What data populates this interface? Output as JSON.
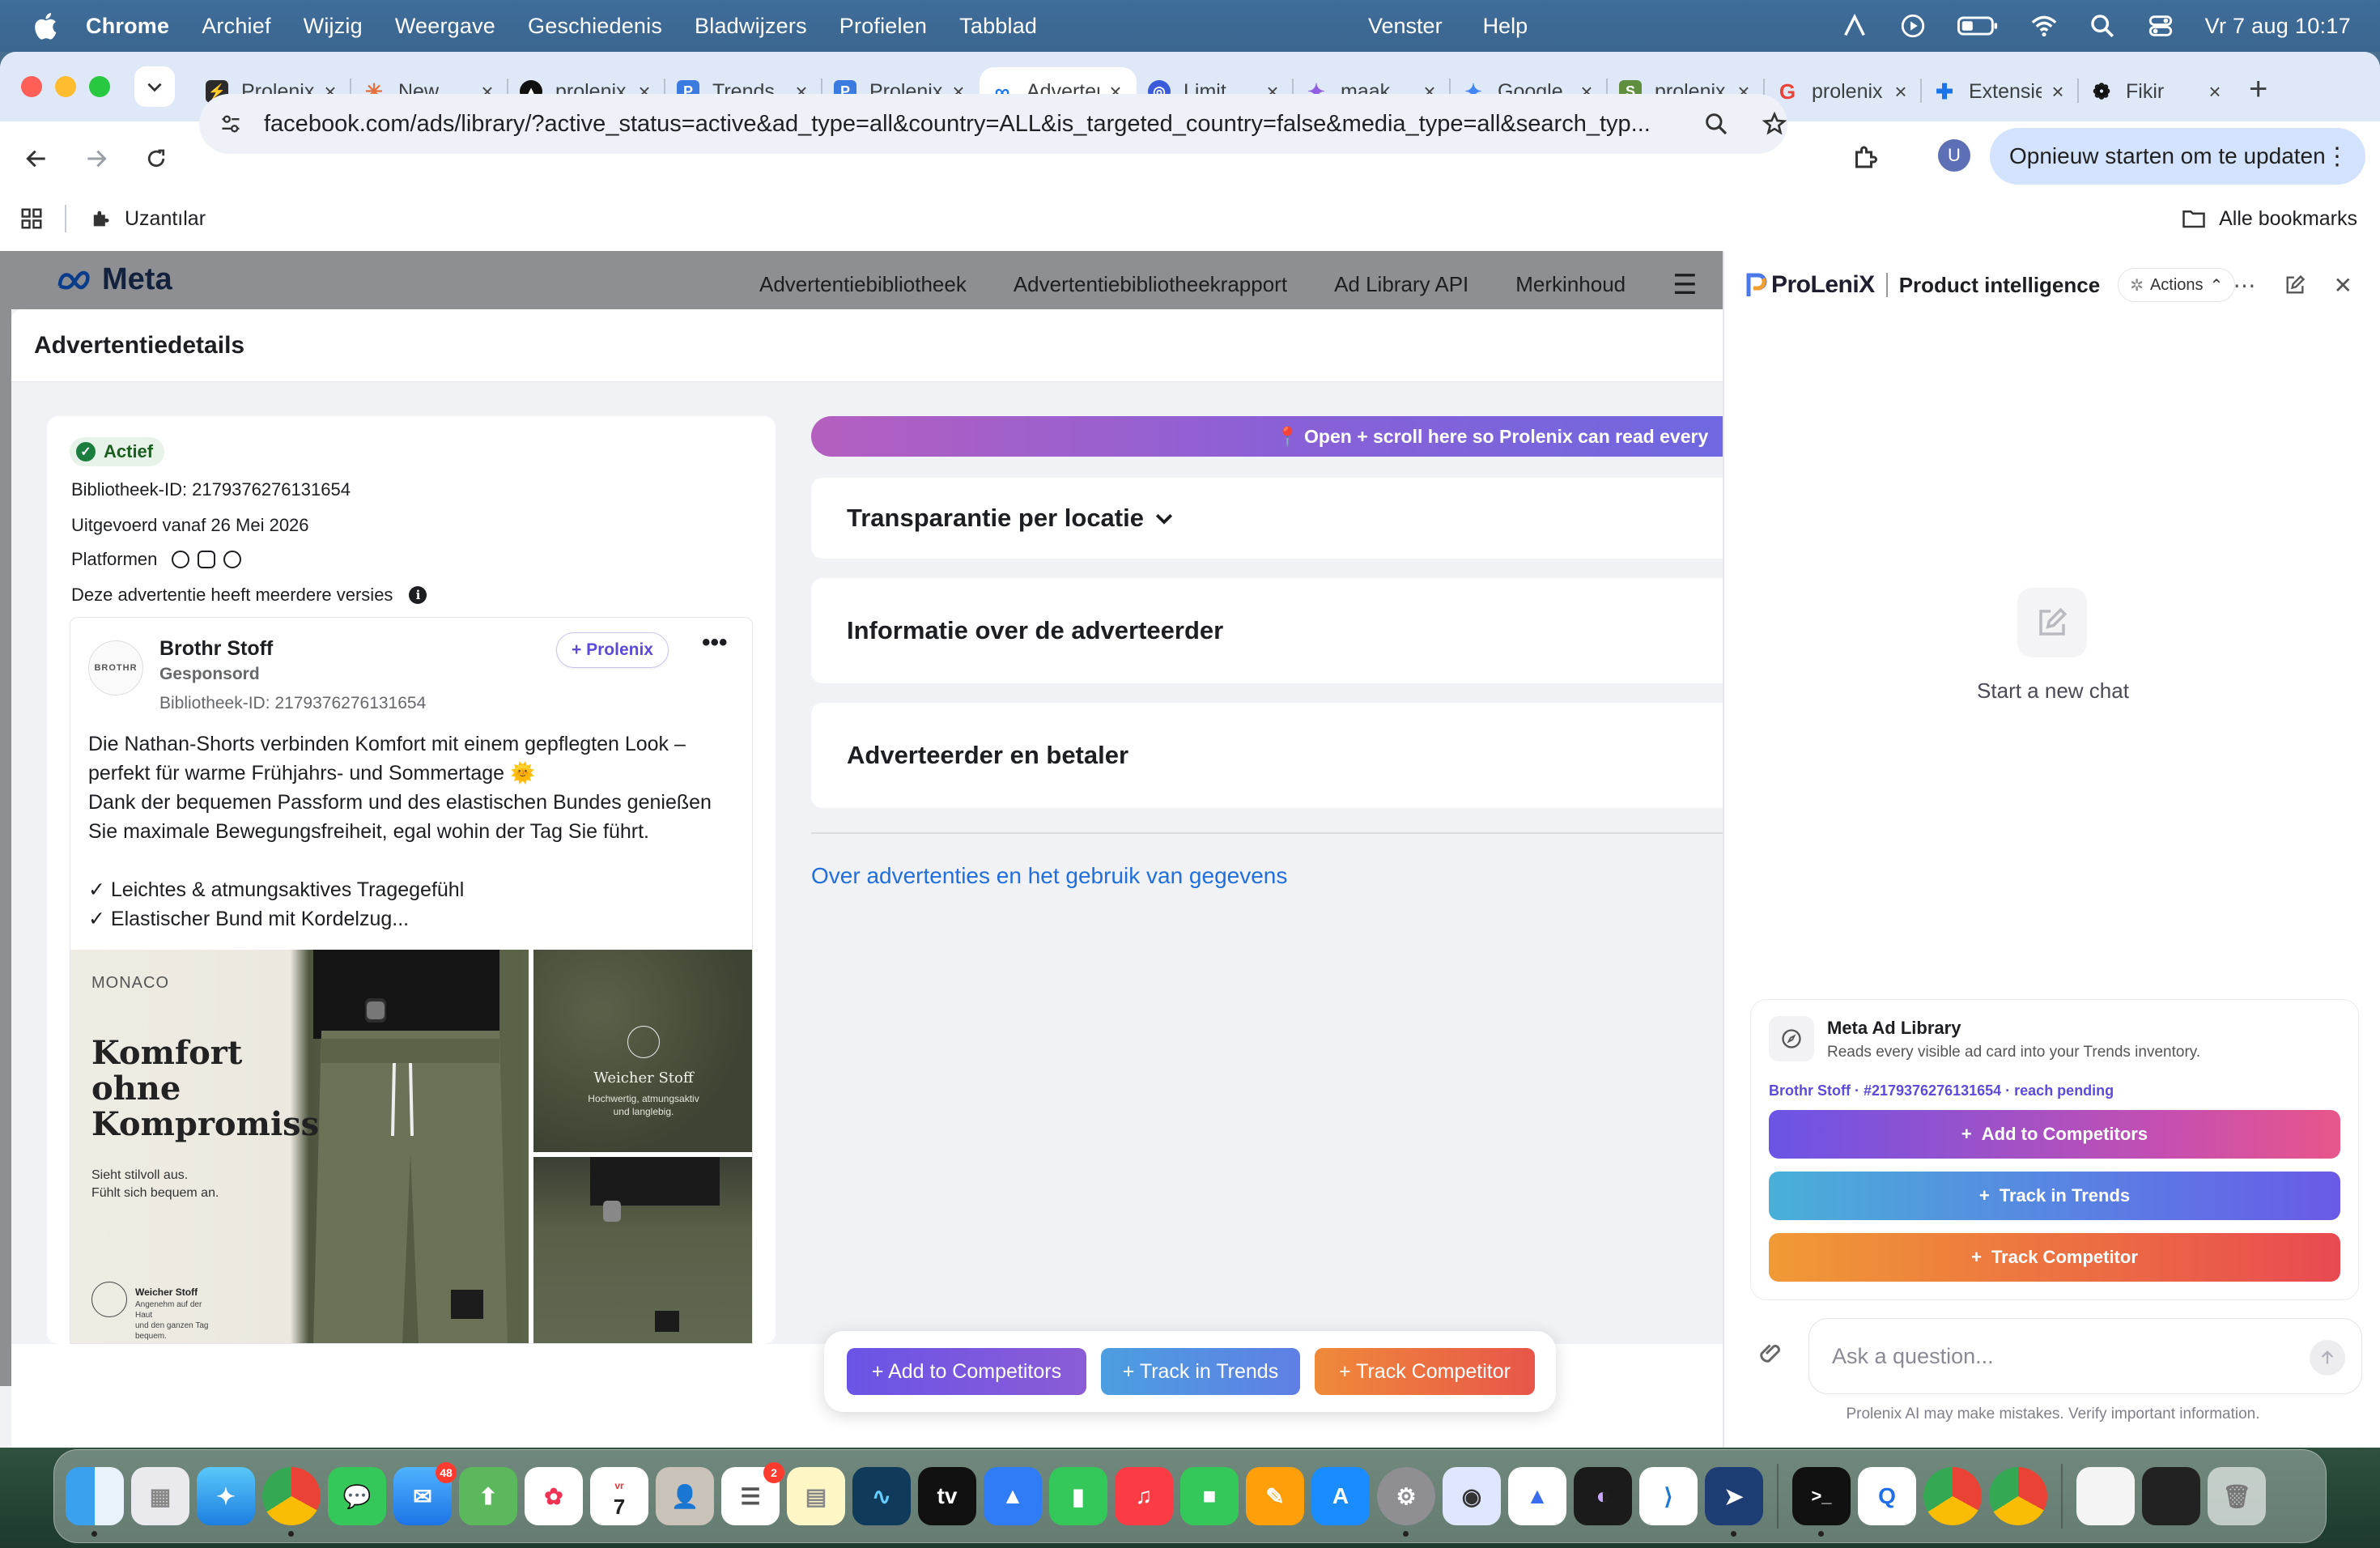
{
  "menubar": {
    "app": "Chrome",
    "menus": [
      "Archief",
      "Wijzig",
      "Weergave",
      "Geschiedenis",
      "Bladwijzers",
      "Profielen",
      "Tabblad"
    ],
    "center_menus": [
      "Venster",
      "Help"
    ],
    "clock": "Vr 7 aug  10:17"
  },
  "tabs": [
    {
      "title": "Prolenix",
      "color": "#2b2b2b"
    },
    {
      "title": "New",
      "color": "#e2703a"
    },
    {
      "title": "prolenix",
      "color": "#111111"
    },
    {
      "title": "Trends",
      "color": "#3b7be0"
    },
    {
      "title": "Prolenix",
      "color": "#3b7be0"
    },
    {
      "title": "Advertentiebibliotheek",
      "color": "#1877f2",
      "active": true
    },
    {
      "title": "Limit",
      "color": "#3b5bdb"
    },
    {
      "title": "maak",
      "color": "#8e5fe0"
    },
    {
      "title": "Google",
      "color": "#4285f4"
    },
    {
      "title": "prolenix",
      "color": "#5e8e3e"
    },
    {
      "title": "prolenix",
      "color": "#ea4335"
    },
    {
      "title": "Extensies",
      "color": "#1a73e8"
    },
    {
      "title": "Fikir",
      "color": "#111111"
    }
  ],
  "omnibox": {
    "url": "facebook.com/ads/library/?active_status=active&ad_type=all&country=ALL&is_targeted_country=false&media_type=all&search_typ..."
  },
  "update_button": "Opnieuw starten om te updaten",
  "bookmarks": {
    "folder": "Uzantılar",
    "all": "Alle bookmarks"
  },
  "meta": {
    "logo": "Meta",
    "nav": [
      "Advertentiebibliotheek",
      "Advertentiebibliotheekrapport",
      "Ad Library API",
      "Merkinhoud"
    ]
  },
  "modal": {
    "title": "Advertentiedetails",
    "status": "Actief",
    "library_id": "Bibliotheek-ID: 2179376276131654",
    "run_from": "Uitgevoerd vanaf 26 Mei 2026",
    "platforms_label": "Platformen",
    "versions_note": "Deze advertentie heeft meerdere versies"
  },
  "ad": {
    "advertiser": "Brothr Stoff",
    "avatar_text": "BROTHR",
    "sponsored": "Gesponsord",
    "library_id": "Bibliotheek-ID: 2179376276131654",
    "prolenix_chip": "+ Prolenix",
    "text": "Die Nathan-Shorts verbinden Komfort mit einem gepflegten Look –\nperfekt für warme Frühjahrs- und Sommertage 🌞\nDank der bequemen Passform und des elastischen Bundes genießen\nSie maximale Bewegungsfreiheit, egal wohin der Tag Sie führt.\n\n✓ Leichtes & atmungsaktives Tragegefühl\n✓ Elastischer Bund mit Kordelzug...",
    "image_brand": "MONACO",
    "image_headline": "Komfort\nohne\nKompromisse.",
    "image_sub": "Sieht stilvoll aus.\nFühlt sich bequem an.",
    "image_badge_title": "Weicher Stoff",
    "image_badge_sub": "Angenehm auf der Haut\nund den ganzen Tag bequem.",
    "image2_title": "Weicher Stoff",
    "image2_sub": "Hochwertig, atmungsaktiv\nund langlebig."
  },
  "right": {
    "banner": "📍 Open + scroll here so Prolenix can read every",
    "sections": [
      "Transparantie per locatie",
      "Informatie over de adverteerder",
      "Adverteerder en betaler"
    ],
    "link": "Over advertenties en het gebruik van gegevens"
  },
  "float_bar": {
    "add_competitors": "+ Add to Competitors",
    "track_trends": "+ Track in Trends",
    "track_competitor": "+ Track Competitor"
  },
  "panel": {
    "brand": "ProLeniX",
    "title": "Product intelligence",
    "actions": "Actions",
    "new_chat": "Start a new chat",
    "card_title": "Meta Ad Library",
    "card_desc": "Reads every visible ad card into your Trends inventory.",
    "card_meta": "Brothr Stoff · #2179376276131654 · reach pending",
    "btn_competitors": "Add to Competitors",
    "btn_trends": "Track in Trends",
    "btn_competitor": "Track Competitor",
    "ask_placeholder": "Ask a question...",
    "disclaimer": "Prolenix AI may make mistakes. Verify important information."
  },
  "colors": {
    "purple_btn": "#6a54e6",
    "blue_btn": "#4c9ee0",
    "orange_btn": "#ef8a3a",
    "link": "#216fdb"
  },
  "dock": {
    "mail_badge": "48",
    "reminders_badge": "2",
    "calendar_month": "vr",
    "calendar_day": "7",
    "appletv_label": "tv"
  }
}
